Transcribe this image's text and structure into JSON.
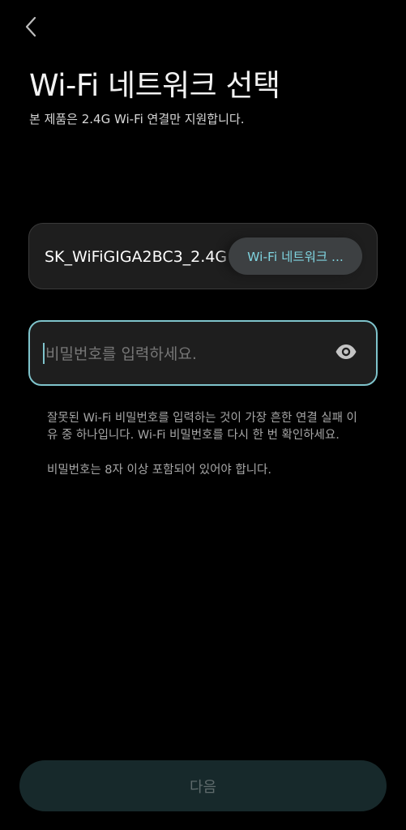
{
  "header": {
    "back_icon": "chevron-left-icon",
    "title": "Wi-Fi 네트워크 선택",
    "subtitle": "본 제품은 2.4G Wi-Fi 연결만 지원합니다."
  },
  "network": {
    "name": "SK_WiFiGIGA2BC3_2.4G",
    "select_label": "Wi-Fi 네트워크 ..."
  },
  "password": {
    "value": "",
    "placeholder": "비밀번호를 입력하세요.",
    "toggle_icon": "eye-icon"
  },
  "hints": {
    "wrong_password": "잘못된 Wi-Fi 비밀번호를 입력하는 것이 가장 흔한 연결 실패 이유 중 하나입니다. Wi-Fi 비밀번호를 다시 한 번 확인하세요.",
    "length_rule": "비밀번호는 8자 이상 포함되어 있어야 합니다."
  },
  "footer": {
    "next_label": "다음"
  },
  "colors": {
    "background": "#000000",
    "card": "#1e1e1e",
    "accent": "#7fc4cc",
    "select_text": "#7fd3df",
    "next_button_bg": "#17292b",
    "next_button_text": "#5f6b6c"
  }
}
